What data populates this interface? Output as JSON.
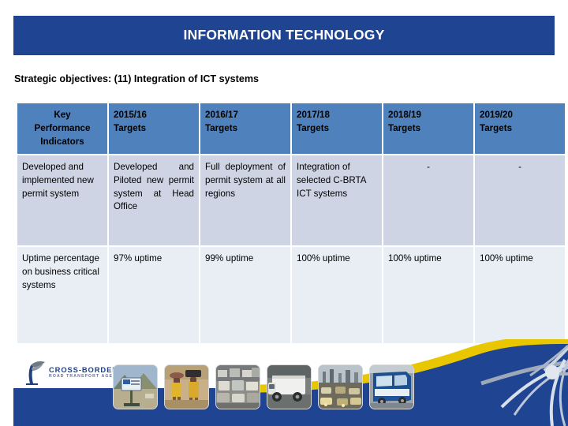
{
  "slide": {
    "title": "INFORMATION TECHNOLOGY",
    "subtitle": "Strategic objectives: (11) Integration of ICT systems",
    "banner_color": "#1f4492",
    "header_row_color": "#4f81bd",
    "row_shade_color": "#ced4e3",
    "row_light_color": "#e9edf4"
  },
  "table": {
    "headers": [
      {
        "line1": "Key",
        "line2": "Performance",
        "line3": "Indicators"
      },
      {
        "line1": "2015/16",
        "line2": "Targets"
      },
      {
        "line1": "2016/17",
        "line2": "Targets"
      },
      {
        "line1": "2017/18",
        "line2": "Targets"
      },
      {
        "line1": "2018/19",
        "line2": "Targets"
      },
      {
        "line1": "2019/20",
        "line2": "Targets"
      }
    ],
    "rows": [
      {
        "kpi": "Developed and implemented new permit system",
        "t2015_16": "Developed and Piloted new permit system at Head Office",
        "t2016_17": "Full deployment of permit system at all regions",
        "t2017_18": "Integration of selected C-BRTA ICT systems",
        "t2018_19": "-",
        "t2019_20": "-"
      },
      {
        "kpi": "Uptime percentage on business critical systems",
        "t2015_16": "97% uptime",
        "t2016_17": "99% uptime",
        "t2017_18": "100% uptime",
        "t2018_19": "100% uptime",
        "t2019_20": "100% uptime"
      }
    ]
  },
  "footer": {
    "logo": {
      "name": "CROSS-BORDER",
      "tagline": "ROAD TRANSPORT AGENCY"
    },
    "thumbnails": [
      "billboard-roadside-photo",
      "people-carrying-loads-photo",
      "traffic-congestion-photo",
      "freight-truck-photo",
      "highway-traffic-dusk-photo",
      "passenger-bus-photo"
    ],
    "wave_color": "#1f4492",
    "accent_color": "#e8c700"
  }
}
